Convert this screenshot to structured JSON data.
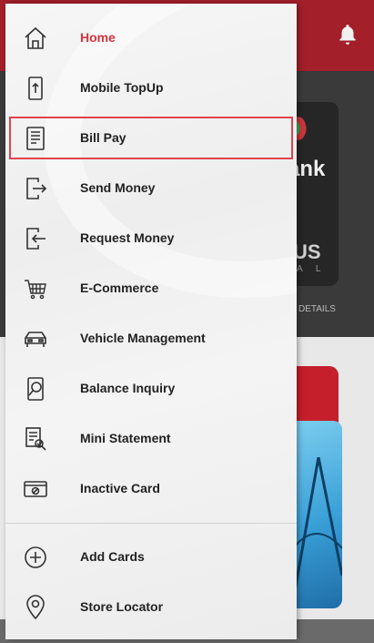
{
  "background": {
    "card_text": "ank",
    "card_brand": "US",
    "card_sub": "A L",
    "details_label": "D DETAILS"
  },
  "menu": [
    {
      "label": "Home",
      "icon": "home-icon",
      "active": true
    },
    {
      "label": "Mobile TopUp",
      "icon": "mobile-topup-icon"
    },
    {
      "label": "Bill Pay",
      "icon": "bill-icon",
      "highlighted": true
    },
    {
      "label": "Send Money",
      "icon": "send-money-icon"
    },
    {
      "label": "Request Money",
      "icon": "request-money-icon"
    },
    {
      "label": "E-Commerce",
      "icon": "cart-icon"
    },
    {
      "label": "Vehicle Management",
      "icon": "car-icon"
    },
    {
      "label": "Balance Inquiry",
      "icon": "balance-inquiry-icon"
    },
    {
      "label": "Mini Statement",
      "icon": "statement-icon"
    },
    {
      "label": "Inactive Card",
      "icon": "inactive-card-icon"
    }
  ],
  "menu_secondary": [
    {
      "label": "Add Cards",
      "icon": "add-circle-icon"
    },
    {
      "label": "Store Locator",
      "icon": "location-pin-icon"
    }
  ],
  "colors": {
    "accent": "#d6343d",
    "header": "#a31f2a",
    "highlight_border": "#e0444c"
  }
}
